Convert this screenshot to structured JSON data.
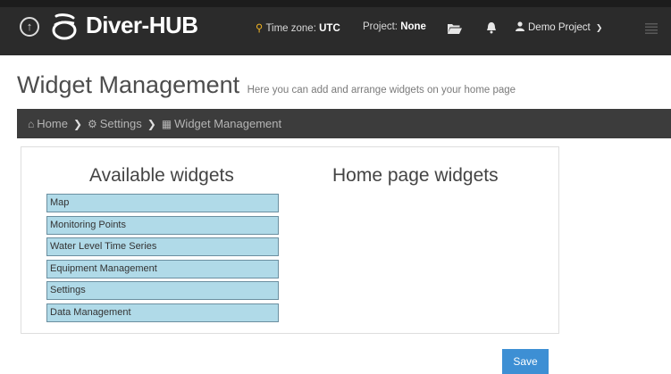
{
  "app": {
    "name": "Diver-HUB",
    "timezone_label": "Time zone:",
    "timezone_value": "UTC",
    "project_label": "Project:",
    "project_value": "None",
    "user_label": "Demo Project"
  },
  "icons": {
    "back": "circle-arrow-up-icon",
    "logo": "diver-logo-icon",
    "timezone": "map-marker-icon",
    "folder": "folder-open-icon",
    "bell": "bell-icon",
    "user": "user-icon",
    "caret": "chevron-down-icon",
    "menu": "hamburger-menu-icon"
  },
  "colors": {
    "navbar": "#2b2b2b",
    "breadcrumb_bg": "#3c3c3c",
    "widget_bg": "#b0dae8",
    "widget_border": "#6b8fa0",
    "save_button": "#3d8fd4",
    "timezone_icon": "#f0b323"
  },
  "page": {
    "title": "Widget Management",
    "subtitle": "Here you can add and arrange widgets on your home page"
  },
  "breadcrumb": [
    {
      "label": "Home",
      "icon": "home-icon"
    },
    {
      "label": "Settings",
      "icon": "gears-icon"
    },
    {
      "label": "Widget Management",
      "icon": "widgets-icon"
    }
  ],
  "available": {
    "title": "Available widgets",
    "widgets": [
      "Map",
      "Monitoring Points",
      "Water Level Time Series",
      "Equipment Management",
      "Settings",
      "Data Management"
    ]
  },
  "home": {
    "title": "Home page widgets",
    "widgets": []
  },
  "actions": {
    "save_label": "Save"
  }
}
